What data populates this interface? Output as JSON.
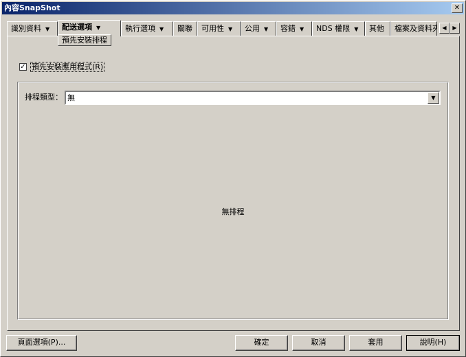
{
  "window": {
    "title": "內容SnapShot",
    "close_glyph": "✕"
  },
  "tabs": [
    {
      "label": "識別資料",
      "dropdown": true
    },
    {
      "label": "配送選項",
      "dropdown": true,
      "active": true
    },
    {
      "label": "執行選項",
      "dropdown": true
    },
    {
      "label": "關聯",
      "dropdown": false
    },
    {
      "label": "可用性",
      "dropdown": true
    },
    {
      "label": "公用",
      "dropdown": true
    },
    {
      "label": "容錯",
      "dropdown": true
    },
    {
      "label": "NDS 權限",
      "dropdown": true
    },
    {
      "label": "其他",
      "dropdown": false
    },
    {
      "label": "檔案及資料夾",
      "dropdown": false
    }
  ],
  "subtab": {
    "label": "預先安裝排程"
  },
  "tab_scroll": {
    "left": "◀",
    "right": "▶"
  },
  "caret_glyph": "▼",
  "checkbox": {
    "label": "預先安裝應用程式(R)",
    "checked": true,
    "check_glyph": "✓"
  },
  "schedule": {
    "type_label": "排程類型：",
    "type_value": "無",
    "dropdown_glyph": "▼",
    "empty_text": "無排程"
  },
  "buttons": {
    "page_options": "頁面選項(P)...",
    "ok": "確定",
    "cancel": "取消",
    "apply": "套用",
    "help": "說明(H)"
  }
}
